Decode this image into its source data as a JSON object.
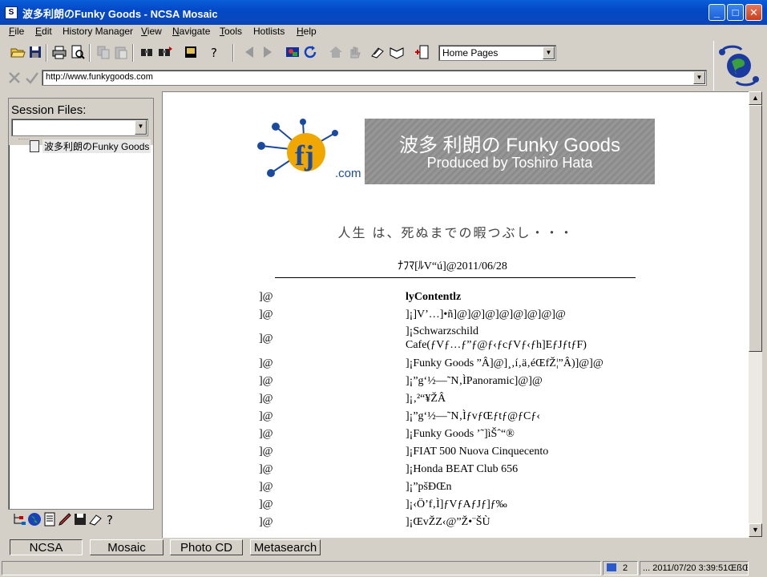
{
  "window": {
    "title": "波多利朗のFunky Goods - NCSA Mosaic",
    "min": "_",
    "max": "□",
    "close": "✕"
  },
  "menu": [
    {
      "label": "File",
      "u": "F",
      "rest": "ile"
    },
    {
      "label": "Edit",
      "u": "E",
      "rest": "dit"
    },
    {
      "label": "History Manager",
      "u": "",
      "rest": "History Manager"
    },
    {
      "label": "View",
      "u": "V",
      "rest": "iew"
    },
    {
      "label": "Navigate",
      "u": "N",
      "rest": "avigate"
    },
    {
      "label": "Tools",
      "u": "T",
      "rest": "ools"
    },
    {
      "label": "Hotlists",
      "u": "",
      "rest": "Hotlists"
    },
    {
      "label": "Help",
      "u": "H",
      "rest": "elp"
    }
  ],
  "toolbar": {
    "home_pages_value": "Home Pages"
  },
  "url": {
    "value": "http://www.funkygoods.com"
  },
  "session": {
    "label": "Session Files:",
    "tree_item": "波多利朗のFunky Goods"
  },
  "page": {
    "banner_title": "波多 利朗の Funky Goods",
    "banner_sub": "Produced by Toshiro Hata",
    "banner_logo_text": ".com",
    "motto": "人生 は、死ぬまでの暇つぶし・・・",
    "updated": "ﾅﾌﾏ[ﾙV“ú]@2011/06/28",
    "rows": [
      {
        "left": "]@",
        "right": "lyContentlz",
        "bold": true
      },
      {
        "left": "]@",
        "right": "]¡]V’…]•ñ]@]@]@]@]@]@]@]@"
      },
      {
        "left": "]@",
        "right": "]¡Schwarzschild",
        "right2": "Cafe(ƒVƒ…ƒ”ƒ@ƒ‹ƒcƒVƒ‹ƒh]EƒJƒtƒF)"
      },
      {
        "left": "]@",
        "right": "]¡Funky Goods ”Â]@]¸‚í‚ä‚éŒfŽ¦”Â)]@]@"
      },
      {
        "left": "]@",
        "right": "]¡”g‘½—˜N‚ÌPanoramic]@]@"
      },
      {
        "left": "]@",
        "right": "]¡‚²“¥ŽÂ"
      },
      {
        "left": "]@",
        "right": "]¡”g‘½—˜N‚ÌƒvƒŒƒtƒ@ƒCƒ‹"
      },
      {
        "left": "]@",
        "right": "]¡Funky Goods ’˜]ìŠˆ“®"
      },
      {
        "left": "]@",
        "right": "]¡FIAT 500 Nuova Cinquecento"
      },
      {
        "left": "]@",
        "right": "]¡Honda BEAT Club 656"
      },
      {
        "left": "]@",
        "right": "]¡”pšÐŒn"
      },
      {
        "left": "]@",
        "right": "]¡‹Ö’f‚Ì]ƒVƒAƒJƒ]ƒ‰"
      },
      {
        "left": "]@",
        "right": "]¡ŒvŽZ‹@”Ž•¨ŠÙ"
      }
    ]
  },
  "tabs": [
    {
      "label": "NCSA",
      "active": true
    },
    {
      "label": "Mosaic",
      "active": false
    },
    {
      "label": "Photo CD",
      "active": false
    },
    {
      "label": "Metasearch",
      "active": false
    }
  ],
  "status": {
    "count": "2",
    "datetime": "... 2011/07/20 3:39:51ŒßŒ"
  },
  "colors": {
    "titlebar": "#0349c7",
    "banner_bg": "#8f8f8f",
    "face": "#d4d0c8"
  }
}
